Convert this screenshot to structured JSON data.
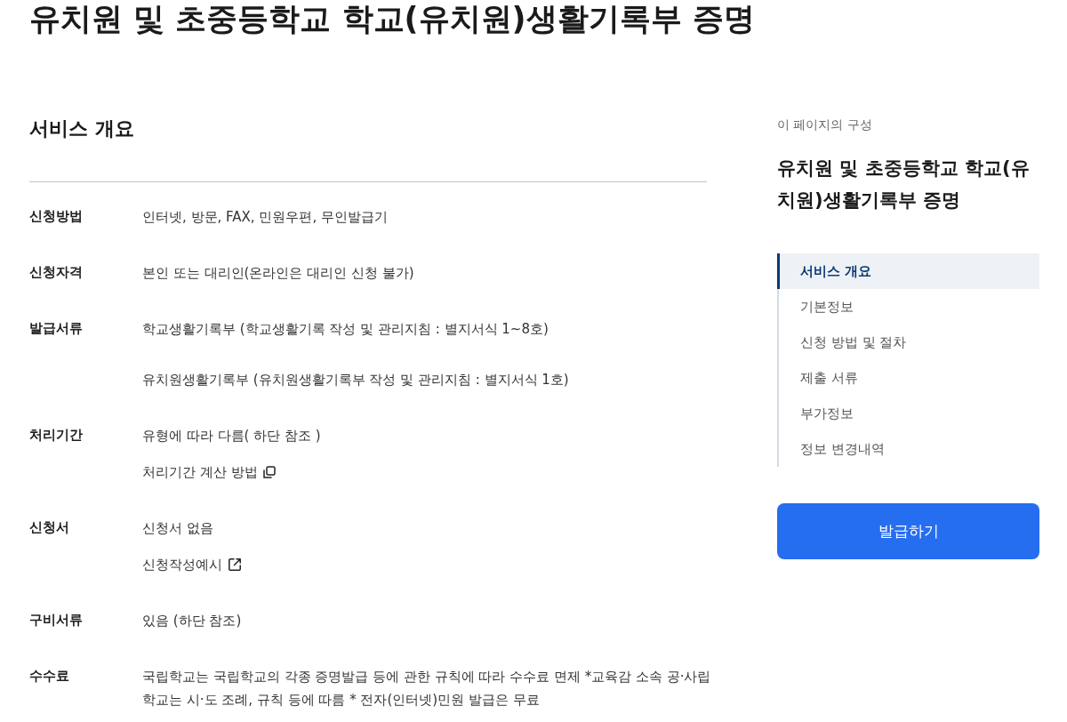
{
  "page_title": "유치원 및 초중등학교 학교(유치원)생활기록부 증명",
  "overview": {
    "heading": "서비스 개요",
    "rows": [
      {
        "label": "신청방법",
        "lines": [
          {
            "kind": "text",
            "text": "인터넷, 방문, FAX, 민원우편, 무인발급기"
          }
        ]
      },
      {
        "label": "신청자격",
        "lines": [
          {
            "kind": "text",
            "text": "본인 또는 대리인(온라인은 대리인 신청 불가)"
          }
        ]
      },
      {
        "label": "발급서류",
        "lines": [
          {
            "kind": "text",
            "text": "학교생활기록부 (학교생활기록 작성 및 관리지침 : 별지서식 1~8호)"
          },
          {
            "kind": "text",
            "text": "유치원생활기록부 (유치원생활기록부 작성 및 관리지침 : 별지서식 1호)"
          }
        ]
      },
      {
        "label": "처리기간",
        "lines": [
          {
            "kind": "text",
            "text": "유형에 따라 다름( 하단 참조 )"
          },
          {
            "kind": "popup_link",
            "text": "처리기간 계산 방법"
          }
        ]
      },
      {
        "label": "신청서",
        "lines": [
          {
            "kind": "text",
            "text": "신청서 없음"
          },
          {
            "kind": "external_link",
            "text": "신청작성예시"
          }
        ]
      },
      {
        "label": "구비서류",
        "lines": [
          {
            "kind": "text",
            "text": "있음 (하단 참조)"
          }
        ]
      },
      {
        "label": "수수료",
        "lines": [
          {
            "kind": "text",
            "text": "국립학교는 국립학교의 각종 증명발급 등에 관한 규칙에 따라 수수료 면제 *교육감 소속 공·사립 학교는 시·도 조례, 규칙 등에 따름 * 전자(인터넷)민원 발급은 무료"
          }
        ]
      }
    ]
  },
  "toc": {
    "caption": "이 페이지의 구성",
    "title": "유치원 및 초중등학교 학교(유치원)생활기록부 증명",
    "items": [
      {
        "label": "서비스 개요",
        "selected": true
      },
      {
        "label": "기본정보",
        "selected": false
      },
      {
        "label": "신청 방법 및 절차",
        "selected": false
      },
      {
        "label": "제출 서류",
        "selected": false
      },
      {
        "label": "부가정보",
        "selected": false
      },
      {
        "label": "정보 변경내역",
        "selected": false
      }
    ]
  },
  "issue_button": "발급하기"
}
